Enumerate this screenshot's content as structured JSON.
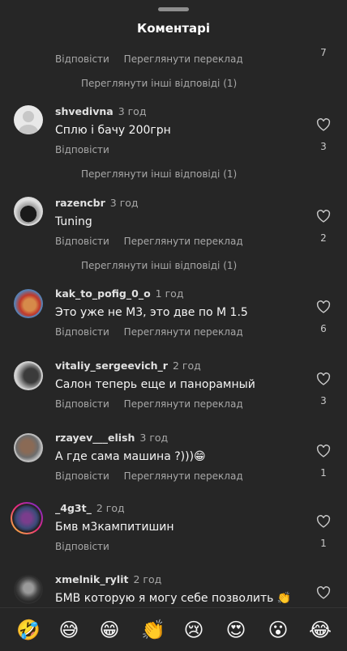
{
  "header": {
    "title": "Коментарі"
  },
  "actions": {
    "reply": "Відповісти",
    "translate": "Переглянути переклад"
  },
  "top": {
    "like_count": "7",
    "more_replies": "Переглянути інші відповіді (1)"
  },
  "comments": [
    {
      "username": "shvedivna",
      "time": "3 год",
      "text": "Сплю і бачу 200грн",
      "likes": "3",
      "more_replies": "Переглянути інші відповіді (1)"
    },
    {
      "username": "razencbr",
      "time": "3 год",
      "text": "Tuning",
      "likes": "2",
      "more_replies": "Переглянути інші відповіді (1)"
    },
    {
      "username": "kak_to_pofig_0_o",
      "time": "1 год",
      "text": "Это уже не М3, это две по М 1.5",
      "likes": "6"
    },
    {
      "username": "vitaliy_sergeevich_r",
      "time": "2 год",
      "text": "Салон теперь еще и панорамный",
      "likes": "3"
    },
    {
      "username": "rzayev___elish",
      "time": "3 год",
      "text": "А где сама машина ?)))😁",
      "likes": "1"
    },
    {
      "username": "_4g3t_",
      "time": "2 год",
      "text": "Бмв  м3кампитишин",
      "likes": "1"
    },
    {
      "username": "xmelnik_rylit",
      "time": "2 год",
      "text": "БМВ которую я могу себе позволить 👏",
      "likes": "1"
    }
  ],
  "emoji_bar": [
    "🤣",
    "😅",
    "😁",
    "👏",
    "😢",
    "😍",
    "😮",
    "😂"
  ]
}
